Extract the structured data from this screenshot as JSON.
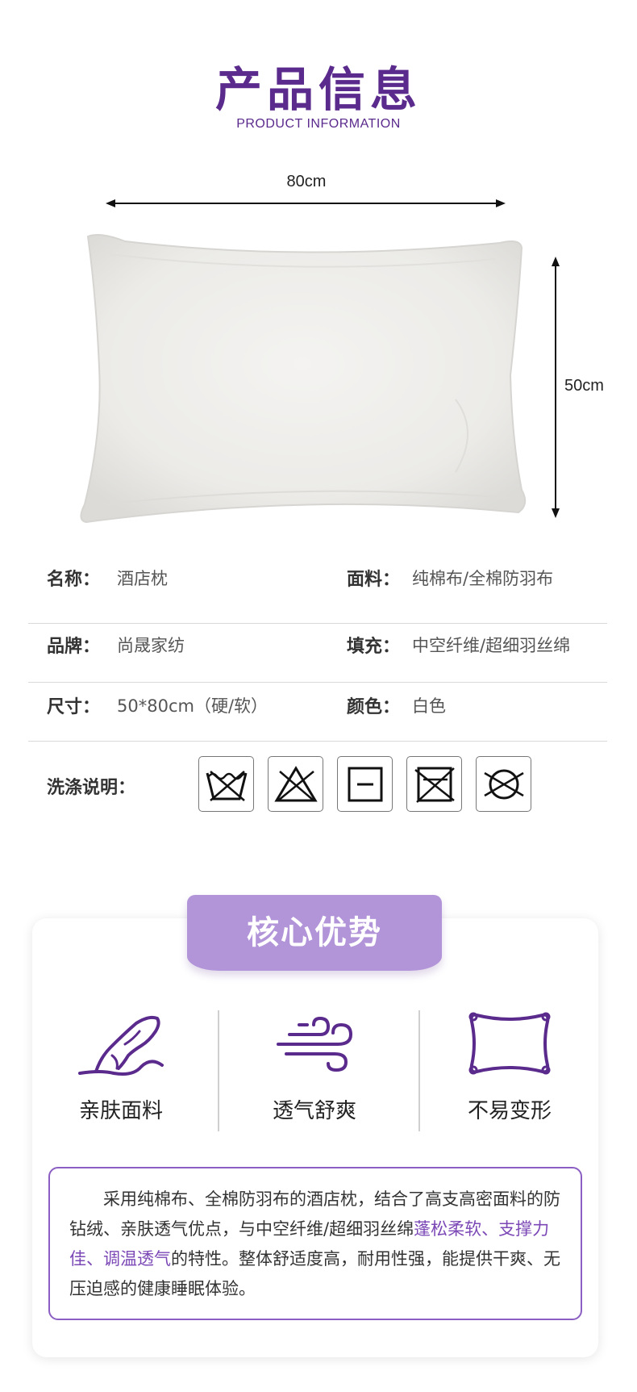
{
  "header": {
    "title": "产品信息",
    "subtitle": "PRODUCT INFORMATION"
  },
  "dimensions": {
    "width": "80cm",
    "height": "50cm"
  },
  "specs": [
    {
      "label": "名称：",
      "value": "酒店枕",
      "label2": "面料：",
      "value2": "纯棉布/全棉防羽布"
    },
    {
      "label": "品牌：",
      "value": "尚晟家纺",
      "label2": "填充：",
      "value2": "中空纤维/超细羽丝绵"
    },
    {
      "label": "尺寸：",
      "value": "50*80cm（硬/软）",
      "label2": "颜色：",
      "value2": "白色"
    }
  ],
  "wash": {
    "label": "洗涤说明：",
    "icons": [
      "hand-wash-icon",
      "do-not-bleach-icon",
      "tumble-dry-icon",
      "do-not-iron-icon",
      "do-not-dry-clean-icon"
    ]
  },
  "advantages": {
    "banner": "核心优势",
    "features": [
      {
        "icon": "hand-touch-icon",
        "label": "亲肤面料"
      },
      {
        "icon": "wind-icon",
        "label": "透气舒爽"
      },
      {
        "icon": "pillow-icon",
        "label": "不易变形"
      }
    ],
    "description": {
      "part1": "采用纯棉布、全棉防羽布的酒店枕，结合了高支高密面料的防钻绒、亲肤透气优点，与中空纤维/超细羽丝绵",
      "highlight": "蓬松柔软、支撑力佳、调温透气",
      "part2": "的特性。整体舒适度高，耐用性强，能提供干爽、无压迫感的健康睡眠体验。"
    }
  },
  "colors": {
    "brand_purple": "#5a2a8c",
    "banner_purple": "#b294d8",
    "highlight_purple": "#7b48b6"
  }
}
